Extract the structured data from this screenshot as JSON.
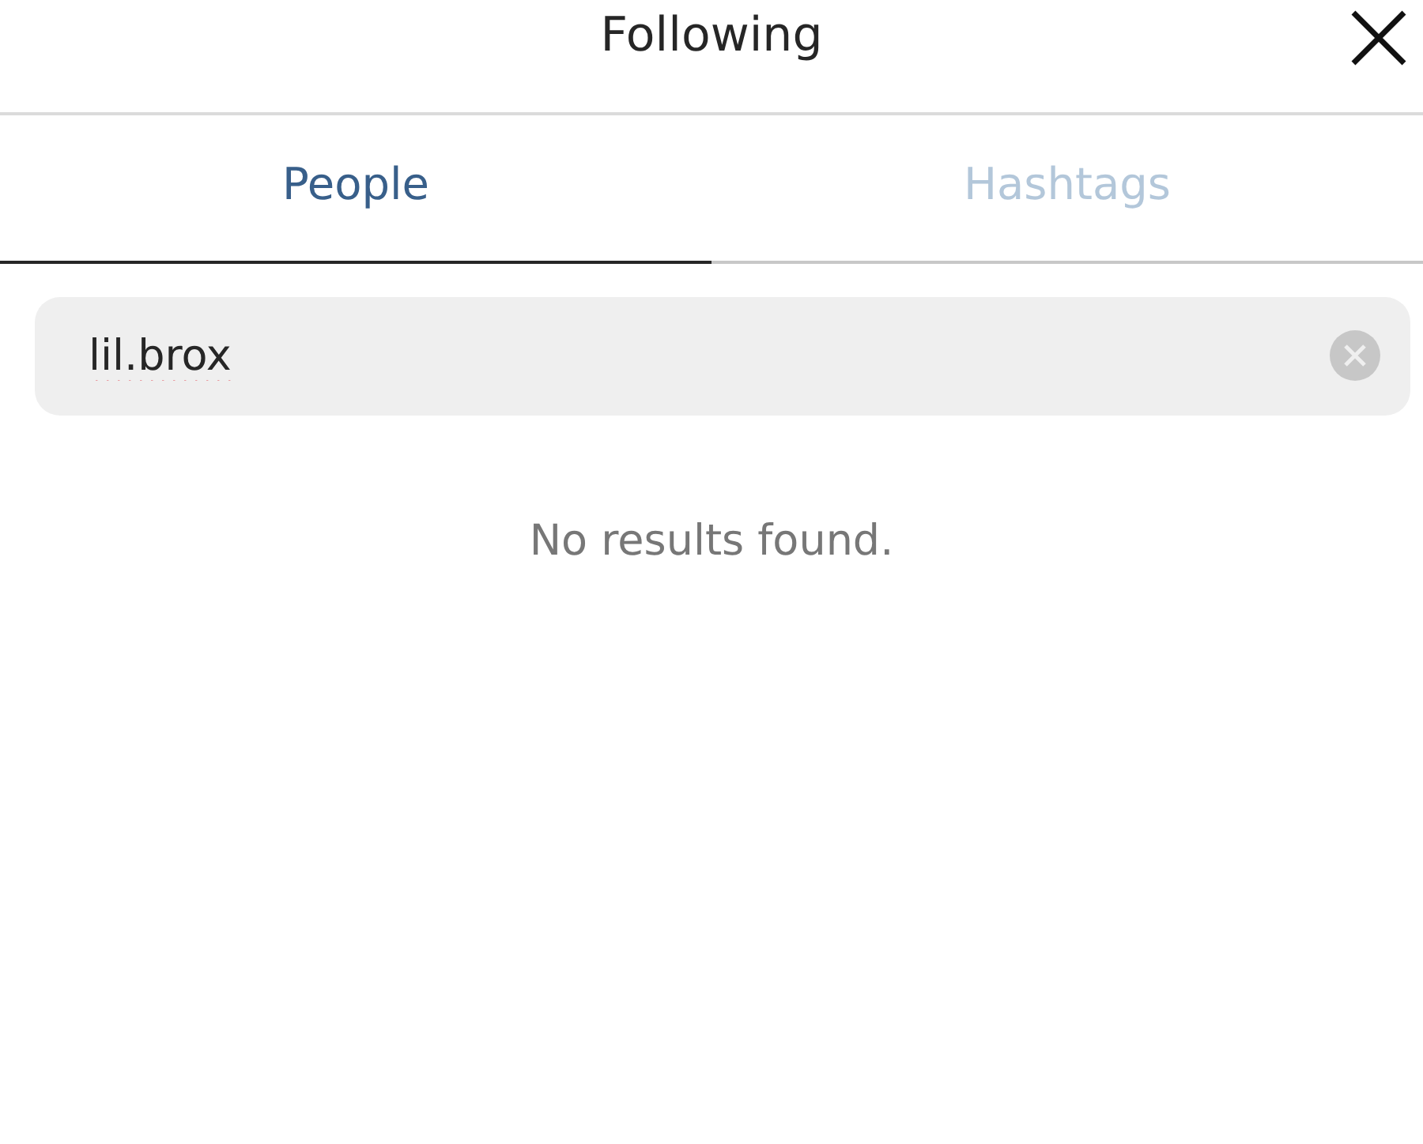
{
  "window": {
    "title": "Following"
  },
  "tabs": [
    {
      "label": "People",
      "selected": true
    },
    {
      "label": "Hashtags",
      "selected": false
    }
  ],
  "search": {
    "value": "lil.brox"
  },
  "message": "No results found."
}
